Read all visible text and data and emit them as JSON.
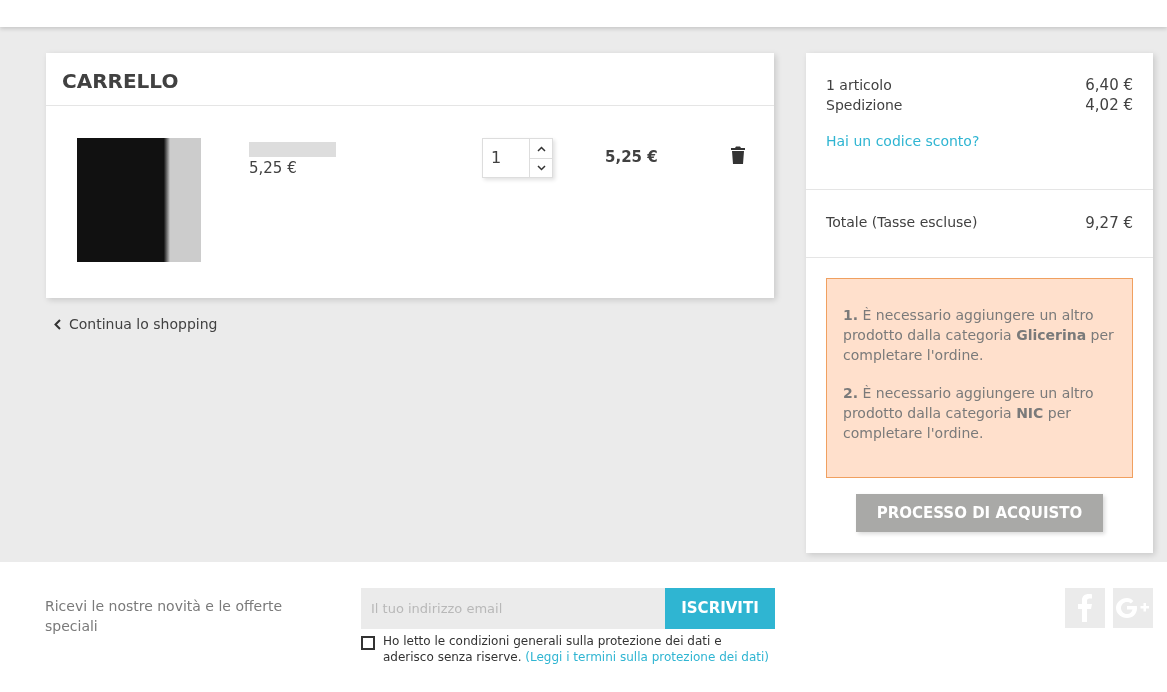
{
  "cart": {
    "title": "CARRELLO",
    "items": [
      {
        "unit_price": "5,25 €",
        "quantity": "1",
        "total": "5,25 €"
      }
    ],
    "continue_link": "Continua lo shopping"
  },
  "summary": {
    "lines": [
      {
        "label": "1 articolo",
        "value": "6,40 €"
      },
      {
        "label": "Spedizione",
        "value": "4,02 €"
      }
    ],
    "promo_link": "Hai un codice sconto?",
    "total": {
      "label": "Totale (Tasse escluse)",
      "value": "9,27 €"
    },
    "alerts": [
      "**1.** È necessario aggiungere un altro prodotto dalla categoria **Glicerina** per completare l'ordine.",
      "**2.** È necessario aggiungere un altro prodotto dalla categoria **NIC** per completare l'ordine."
    ],
    "checkout_button": {
      "label": "PROCESSO DI ACQUISTO",
      "disabled": true
    }
  },
  "footer": {
    "newsletter_text": "Ricevi le nostre novità e le offerte speciali",
    "email": {
      "placeholder": "Il tuo indirizzo email"
    },
    "subscribe_button": "ISCRIVITI",
    "consent": {
      "checked": false,
      "text": "Ho letto le condizioni generali sulla protezione dei dati e aderisco senza riserve.",
      "link": "(Leggi i termini sulla protezione dei dati)"
    }
  }
}
